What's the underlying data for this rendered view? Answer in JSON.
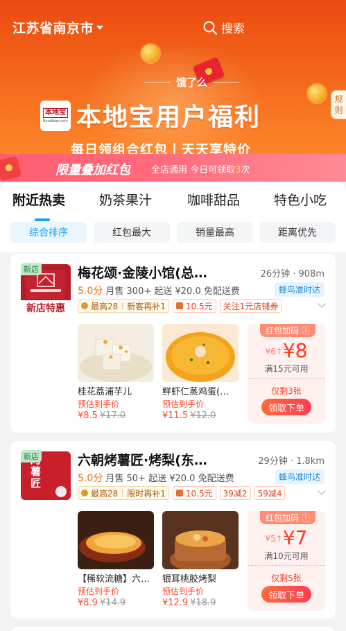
{
  "header": {
    "city": "江苏省南京市",
    "search_label": "搜索"
  },
  "banner": {
    "brand": "饿了么",
    "logo_text": "本地宝",
    "logo_sub": "Bendibao.com",
    "title": "本地宝用户福利",
    "subtitle": "每日领组合红包丨天天享特价",
    "rule_label": "规则",
    "stack": {
      "title": "限量叠加红包",
      "desc_prefix": "全店通用 今日可领取",
      "count": "3",
      "desc_suffix": "次"
    }
  },
  "tabs": [
    {
      "label": "附近热卖",
      "active": true
    },
    {
      "label": "奶茶果汁",
      "active": false
    },
    {
      "label": "咖啡甜品",
      "active": false
    },
    {
      "label": "特色小吃",
      "active": false
    }
  ],
  "sort_options": [
    {
      "label": "综合排序",
      "active": true
    },
    {
      "label": "红包最大",
      "active": false
    },
    {
      "label": "销量最高",
      "active": false
    },
    {
      "label": "距离优先",
      "active": false
    }
  ],
  "shops": [
    {
      "badge": "新店",
      "logo_caption": "新店特惠",
      "name": "梅花颂·金陵小馆(总…",
      "eta": "26分钟 · 908m",
      "score": "5.0分",
      "stats": "月售 300+ 起送 ¥20.0 免配送费",
      "delivery": "蜂鸟准时达",
      "promos": {
        "gold_a": "最高28",
        "gold_b": "新客再补1",
        "p1": "10.5元",
        "p2": "关注1元店铺券"
      },
      "dishes": [
        {
          "name": "桂花荔浦芋儿",
          "est": "预估到手价",
          "price": "¥8.5",
          "orig": "¥17.0"
        },
        {
          "name": "鲜虾仁蒸鸡蛋(…",
          "est": "预估到手价",
          "price": "¥11.5",
          "orig": "¥12.0"
        }
      ],
      "bonus": {
        "head": "红包加码",
        "from": "¥6",
        "to": "¥8",
        "cond": "满15元可用",
        "left": "仅剩3张",
        "btn": "领取下单"
      }
    },
    {
      "badge": "新店",
      "logo_caption": "烤薯匠",
      "name": "六朝烤薯匠·烤梨(东…",
      "eta": "29分钟 · 1.8km",
      "score": "5.0分",
      "stats": "月售 50+ 起送 ¥20.0 免配送费",
      "delivery": "蜂鸟准时达",
      "promos": {
        "gold_a": "最高28",
        "gold_b": "限时再补1",
        "p1": "10.5元",
        "p2": "39减2",
        "p3": "59减4"
      },
      "dishes": [
        {
          "name": "【稀软流糖】六…",
          "est": "预估到手价",
          "price": "¥8.9",
          "orig": "¥14.9"
        },
        {
          "name": "银耳桃胶烤梨",
          "est": "预估到手价",
          "price": "¥12.9",
          "orig": "¥18.9"
        }
      ],
      "bonus": {
        "head": "红包加码",
        "from": "¥5",
        "to": "¥7",
        "cond": "满10元可用",
        "left": "仅剩5张",
        "btn": "领取下单"
      }
    }
  ],
  "colors": {
    "accent_blue": "#1aa1f1",
    "price_red": "#ff4a2c",
    "banner_orange": "#f46a1c"
  }
}
